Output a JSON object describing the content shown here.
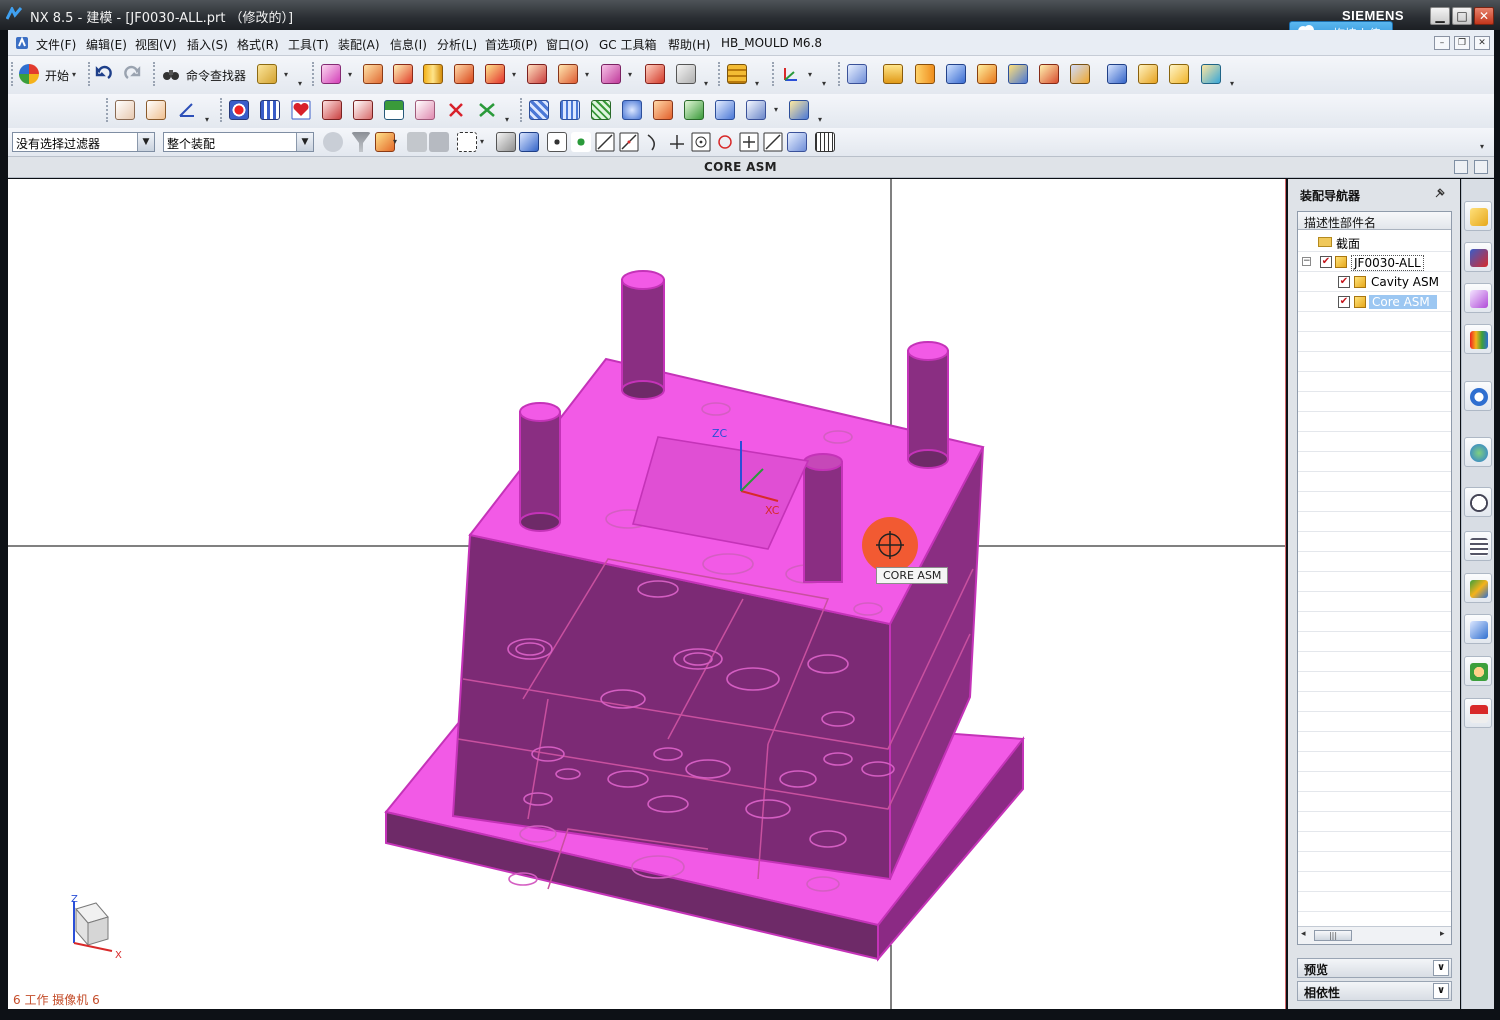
{
  "window": {
    "title": "NX 8.5 - 建模 - [JF0030-ALL.prt （修改的）]",
    "brand": "SIEMENS",
    "upload_label": "拖拽上传",
    "min_glyph": "▁",
    "max_glyph": "□",
    "close_glyph": "✕"
  },
  "menu": {
    "items": [
      "文件(F)",
      "编辑(E)",
      "视图(V)",
      "插入(S)",
      "格式(R)",
      "工具(T)",
      "装配(A)",
      "信息(I)",
      "分析(L)",
      "首选项(P)",
      "窗口(O)",
      "GC 工具箱",
      "帮助(H)",
      "HB_MOULD M6.8"
    ],
    "mdi_min": "–",
    "mdi_restore": "❐",
    "mdi_close": "✕"
  },
  "toolbar": {
    "start_label": "开始",
    "command_finder_label": "命令查找器"
  },
  "selection": {
    "filter_value": "没有选择过滤器",
    "scope_value": "整个装配"
  },
  "viewport": {
    "caption": "CORE ASM",
    "tooltip": "CORE ASM",
    "status": "6 工作 摄像机 6",
    "axis_x": "X",
    "axis_z": "Z",
    "zc": "ZC",
    "xc": "XC",
    "model_color": "#f25ae6",
    "model_edge": "#c433b8",
    "model_dark": "#6e2a68"
  },
  "navigator": {
    "title": "装配导航器",
    "column_header": "描述性部件名",
    "rows": [
      {
        "label": "截面"
      },
      {
        "label": "JF0030-ALL",
        "checked": "✔"
      },
      {
        "label": "Cavity ASM",
        "checked": "✔"
      },
      {
        "label": "Core ASM",
        "checked": "✔"
      }
    ],
    "expand_glyph": "−",
    "scroll_thumb": "|||",
    "scroll_left": "◂",
    "scroll_right": "▸",
    "panels": [
      {
        "label": "预览"
      },
      {
        "label": "相依性"
      }
    ],
    "chevron": "∨",
    "selected_color": "#9cc7f2"
  }
}
